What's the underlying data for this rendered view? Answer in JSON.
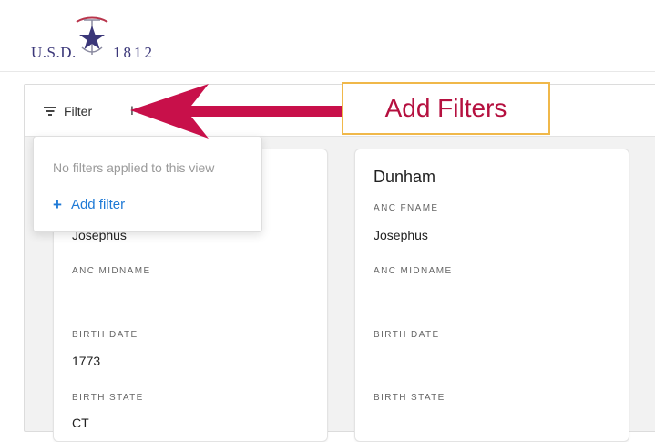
{
  "logo": {
    "left_text": "U.S.D.",
    "right_text": "1812"
  },
  "toolbar": {
    "filter_label": "Filter",
    "truncated_text": "I"
  },
  "cards": [
    {
      "title": "",
      "fields": [
        {
          "label": "",
          "value": "Josephus"
        },
        {
          "label": "ANC MIDNAME",
          "value": ""
        },
        {
          "label": "BIRTH DATE",
          "value": "1773"
        },
        {
          "label": "BIRTH STATE",
          "value": "CT"
        }
      ]
    },
    {
      "title": "Dunham",
      "fields": [
        {
          "label": "ANC FNAME",
          "value": "Josephus"
        },
        {
          "label": "ANC MIDNAME",
          "value": ""
        },
        {
          "label": "BIRTH DATE",
          "value": ""
        },
        {
          "label": "BIRTH STATE",
          "value": ""
        }
      ]
    }
  ],
  "filter_dropdown": {
    "empty_text": "No filters applied to this view",
    "add_label": "Add filter"
  },
  "annotation": {
    "callout_text": "Add Filters",
    "arrow_color": "#c8104a",
    "border_color": "#f0b84a"
  },
  "colors": {
    "accent": "#1f7ad6",
    "brand": "#3b3779"
  },
  "icons": [
    "filter-icon",
    "plus-icon",
    "usd-1812-logo-icon"
  ]
}
